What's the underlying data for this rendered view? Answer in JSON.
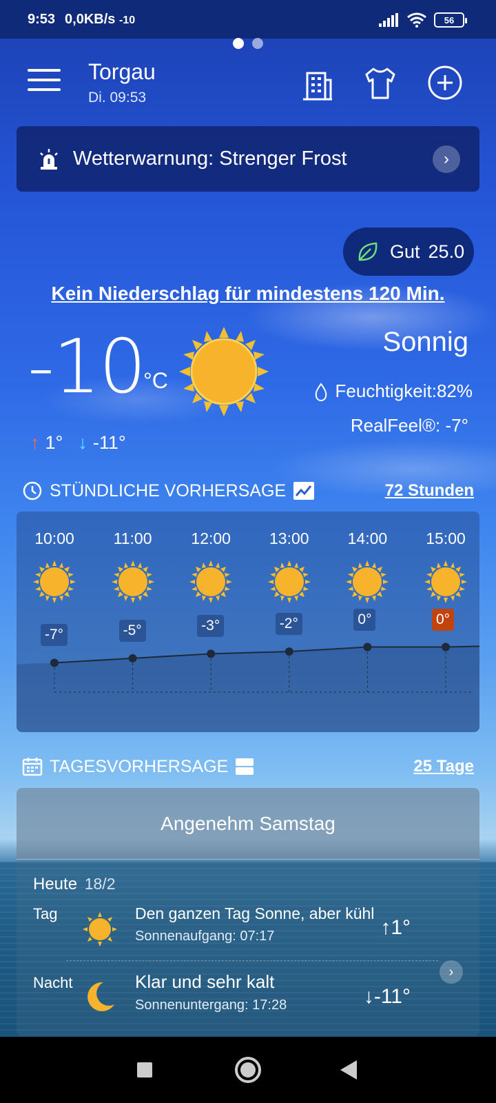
{
  "status": {
    "time": "9:53",
    "net": "0,0KB/s",
    "temp": "-10",
    "battery": "56"
  },
  "header": {
    "city": "Torgau",
    "time": "Di. 09:53"
  },
  "warning": {
    "text": "Wetterwarnung: Strenger Frost"
  },
  "aqi": {
    "label": "Gut",
    "value": "25.0",
    "color": "#6ee07a"
  },
  "precip": "Kein Niederschlag für mindestens 120 Min.",
  "current": {
    "temp": "-10",
    "unit": "°C",
    "condition": "Sonnig",
    "humidity": "Feuchtigkeit:82%",
    "realfeel": "RealFeel®: -7°",
    "high": "1°",
    "low": "-11°"
  },
  "hourly": {
    "title": "STÜNDLICHE VORHERSAGE",
    "link": "72 Stunden",
    "hours": [
      {
        "time": "10:00",
        "temp": "-7°"
      },
      {
        "time": "11:00",
        "temp": "-5°"
      },
      {
        "time": "12:00",
        "temp": "-3°"
      },
      {
        "time": "13:00",
        "temp": "-2°"
      },
      {
        "time": "14:00",
        "temp": "0°"
      },
      {
        "time": "15:00",
        "temp": "0°"
      }
    ]
  },
  "daily": {
    "title": "TAGESVORHERSAGE",
    "link": "25 Tage",
    "banner": "Angenehm Samstag",
    "today_label": "Heute",
    "today_date": "18/2",
    "day": {
      "label": "Tag",
      "desc": "Den ganzen Tag Sonne, aber kühl",
      "sub": "Sonnenaufgang: 07:17",
      "temp": "↑1°"
    },
    "night": {
      "label": "Nacht",
      "desc": "Klar und sehr kalt",
      "sub": "Sonnenuntergang: 17:28",
      "temp": "↓-11°"
    }
  },
  "icons": {
    "menu": "hamburger-icon",
    "building": "building-icon",
    "shirt": "shirt-icon",
    "add": "plus-circle-icon",
    "warning": "siren-icon",
    "leaf": "leaf-icon",
    "sun": "sun-icon",
    "moon": "moon-icon",
    "clock": "clock-icon",
    "chart": "chart-icon",
    "calendar": "calendar-icon",
    "list": "list-icon"
  },
  "colors": {
    "status_bar": "#0f2a78",
    "hot_label": "#c1440e",
    "sun": "#f7b32b"
  }
}
